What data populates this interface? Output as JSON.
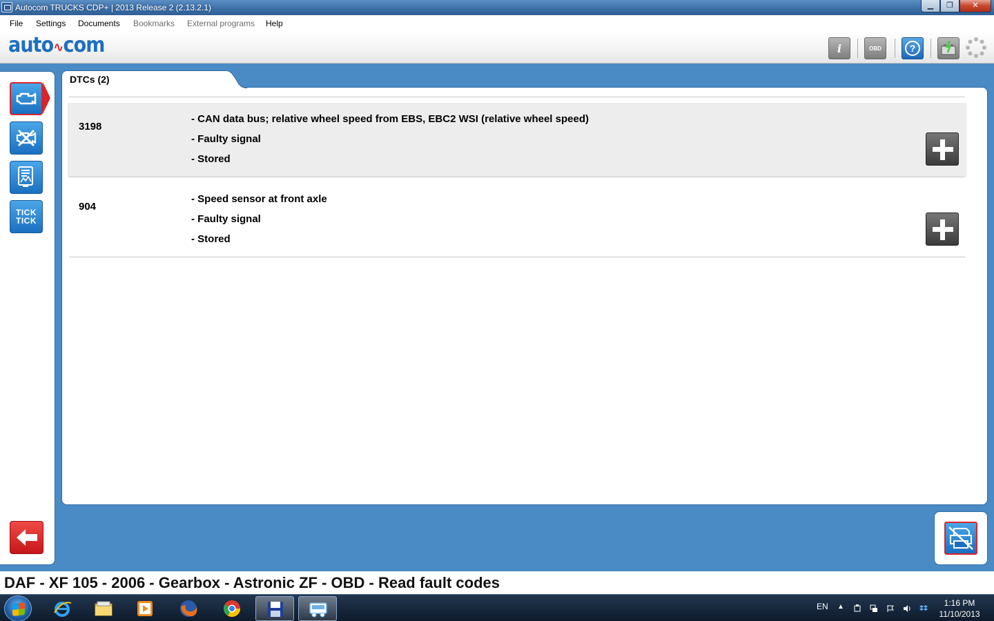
{
  "window": {
    "title": "Autocom TRUCKS CDP+ | 2013 Release 2 (2.13.2.1)",
    "minimize": "▁",
    "maximize": "❐",
    "close": "✕"
  },
  "menu": [
    {
      "label": "File",
      "enabled": true
    },
    {
      "label": "Settings",
      "enabled": true
    },
    {
      "label": "Documents",
      "enabled": true
    },
    {
      "label": "Bookmarks",
      "enabled": false
    },
    {
      "label": "External programs",
      "enabled": false
    },
    {
      "label": "Help",
      "enabled": true
    }
  ],
  "brand": {
    "logo_left": "auto",
    "logo_right": "com",
    "primary_color": "#1e6fbf",
    "accent_color": "#d8262b"
  },
  "toolbar": {
    "info_icon": "info-icon",
    "info_glyph": "i",
    "obd_icon": "obd-icon",
    "obd_glyph": "OBD",
    "help_icon": "help-icon",
    "help_glyph": "?",
    "battery_icon": "battery-icon",
    "spinner_icon": "spinner-icon"
  },
  "sidebar": {
    "items": [
      {
        "name": "engine-icon",
        "active": true
      },
      {
        "name": "clear-codes-icon",
        "active": false
      },
      {
        "name": "live-data-icon",
        "active": false
      },
      {
        "name": "tick-tick-icon",
        "label_top": "TICK",
        "label_bottom": "TICK",
        "active": false
      }
    ],
    "back_icon": "back-arrow-icon"
  },
  "main": {
    "tab_label": "DTCs (2)",
    "dtcs": [
      {
        "code": "3198",
        "lines": [
          "- CAN data bus; relative wheel speed from EBS, EBC2 WSI (relative wheel speed)",
          "- Faulty signal",
          "- Stored"
        ]
      },
      {
        "code": "904",
        "lines": [
          "- Speed sensor at front axle",
          "- Faulty signal",
          "- Stored"
        ]
      }
    ]
  },
  "print_icon": "print-icon",
  "breadcrumb": "DAF - XF 105 - 2006 - Gearbox - Astronic ZF - OBD - Read fault codes",
  "taskbar": {
    "apps": [
      "internet-explorer-icon",
      "file-explorer-icon",
      "media-player-icon",
      "firefox-icon",
      "chrome-icon",
      "save-disk-icon",
      "truck-app-icon"
    ],
    "language": "EN",
    "time": "1:16 PM",
    "date": "11/10/2013"
  }
}
